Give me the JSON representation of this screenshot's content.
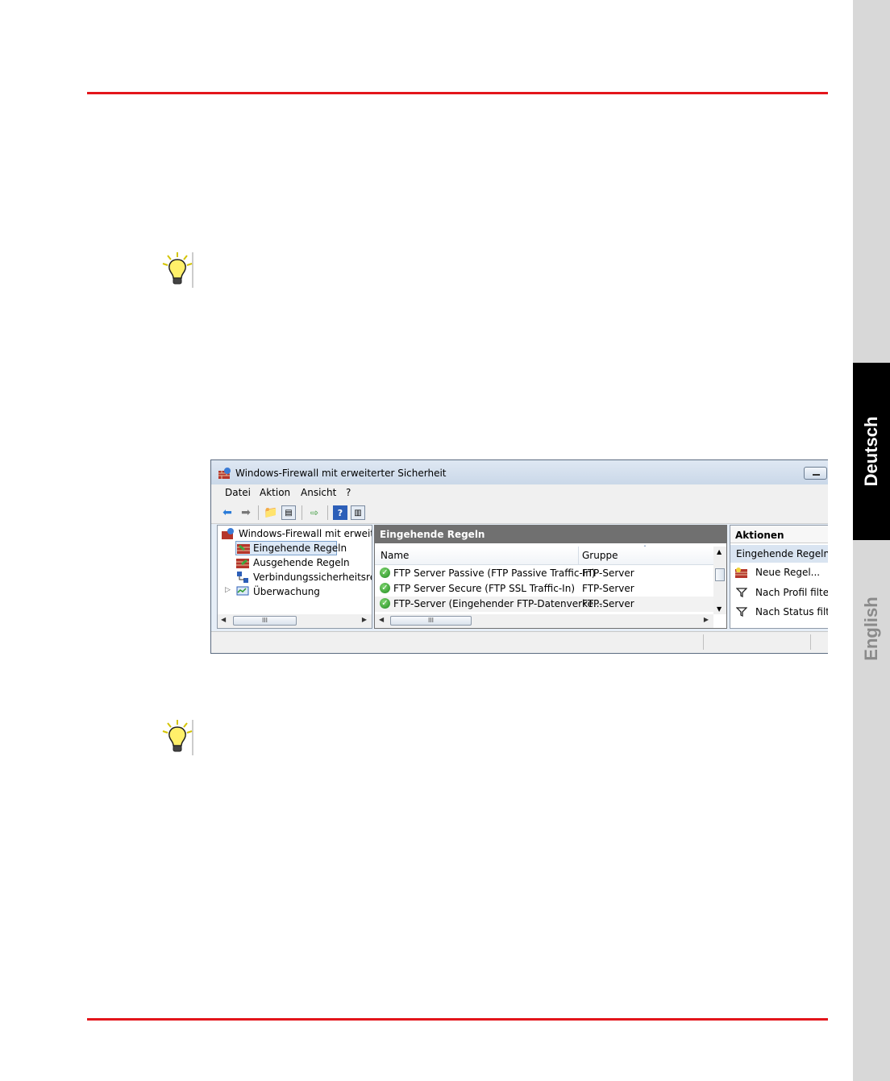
{
  "side_tabs": {
    "deutsch": "Deutsch",
    "english": "English"
  },
  "window": {
    "title": "Windows-Firewall mit erweiterter Sicherheit",
    "menu": [
      "Datei",
      "Aktion",
      "Ansicht",
      "?"
    ],
    "tree": {
      "root": "Windows-Firewall mit erweitert",
      "items": [
        {
          "label": "Eingehende Regeln",
          "icon": "inbound-rules-icon",
          "selected": true
        },
        {
          "label": "Ausgehende Regeln",
          "icon": "outbound-rules-icon"
        },
        {
          "label": "Verbindungssicherheitsrege",
          "icon": "connection-security-icon"
        },
        {
          "label": "Überwachung",
          "icon": "monitoring-icon"
        }
      ]
    },
    "rules": {
      "header": "Eingehende Regeln",
      "columns": [
        "Name",
        "Gruppe"
      ],
      "rows": [
        {
          "name": "FTP Server Passive (FTP Passive Traffic-In)",
          "group": "FTP-Server"
        },
        {
          "name": "FTP Server Secure (FTP SSL Traffic-In)",
          "group": "FTP-Server"
        },
        {
          "name": "FTP-Server (Eingehender FTP-Datenverke...",
          "group": "FTP-Server"
        }
      ]
    },
    "actions": {
      "header": "Aktionen",
      "subheader": "Eingehende Regeln",
      "items": [
        "Neue Regel...",
        "Nach Profil filtern",
        "Nach Status filtern"
      ]
    },
    "scroll_thumb_glyph": "III"
  },
  "colors": {
    "accent_red": "#e3151b",
    "tab_active": "#000000",
    "tab_inactive": "#d8d8d8"
  }
}
